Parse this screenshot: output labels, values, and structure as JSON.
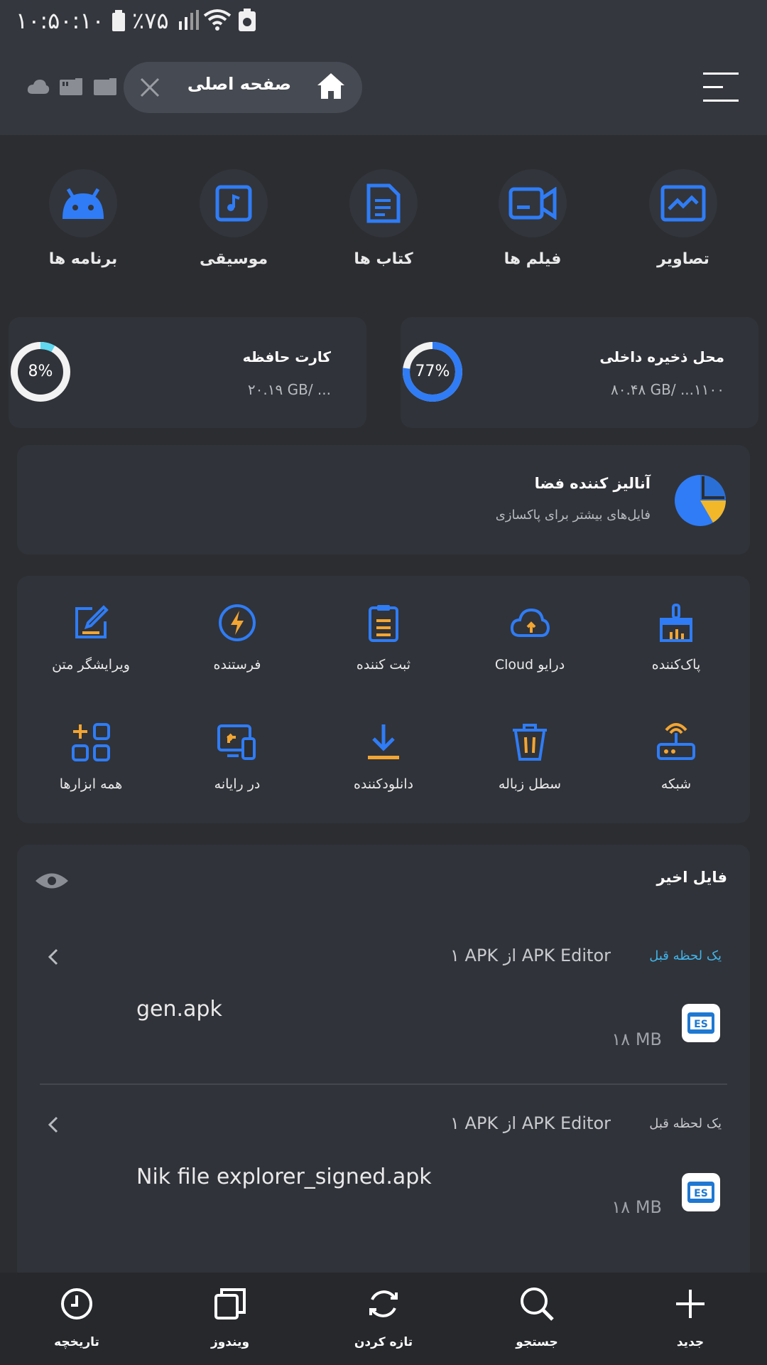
{
  "status_bar": {
    "time": "۱۰:۵۰:۱۰",
    "battery": "٪۷۵"
  },
  "header": {
    "tab_title": "صفحه اصلی"
  },
  "categories": [
    {
      "label": "تصاویر",
      "icon": "image-icon"
    },
    {
      "label": "فیلم ها",
      "icon": "video-icon"
    },
    {
      "label": "کتاب ها",
      "icon": "document-icon"
    },
    {
      "label": "موسیقی",
      "icon": "music-icon"
    },
    {
      "label": "برنامه ها",
      "icon": "android-icon"
    }
  ],
  "storage": {
    "internal": {
      "title": "محل ذخیره داخلی",
      "usage": "۸۰.۴۸ GB/ ...۱۱۰۰",
      "percent": "77%",
      "fraction": 0.77
    },
    "sdcard": {
      "title": "کارت حافظه",
      "usage": "۲۰.۱۹ GB/ ...",
      "percent": "8%",
      "fraction": 0.08
    }
  },
  "analyzer": {
    "title": "آنالیز کننده فضا",
    "subtitle": "فایل‌های بیشتر برای پاکسازی"
  },
  "tools": [
    {
      "label": "پاک‌کننده",
      "icon": "broom-icon"
    },
    {
      "label": "Cloud درایو",
      "icon": "cloud-upload-icon"
    },
    {
      "label": "ثبت کننده",
      "icon": "clipboard-icon"
    },
    {
      "label": "فرستنده",
      "icon": "lightning-icon"
    },
    {
      "label": "ویرایشگر متن",
      "icon": "edit-icon"
    },
    {
      "label": "شبکه",
      "icon": "router-icon"
    },
    {
      "label": "سطل زباله",
      "icon": "trash-icon"
    },
    {
      "label": "دانلودکننده",
      "icon": "download-icon"
    },
    {
      "label": "در رایانه",
      "icon": "cast-icon"
    },
    {
      "label": "همه ابزارها",
      "icon": "grid-icon"
    }
  ],
  "recent": {
    "title": "فایل اخیر",
    "items": [
      {
        "time": "یک لحظه قبل",
        "source": "۱ APK از APK Editor",
        "name": "gen.apk",
        "size": "۱۸ MB"
      },
      {
        "time": "یک لحظه قبل",
        "source": "۱ APK از APK Editor",
        "name": "Nik file explorer_signed.apk",
        "size": "۱۸ MB"
      }
    ]
  },
  "bottom_nav": [
    {
      "label": "جدید",
      "icon": "plus-icon"
    },
    {
      "label": "جستجو",
      "icon": "search-icon"
    },
    {
      "label": "تازه کردن",
      "icon": "refresh-icon"
    },
    {
      "label": "ویندوز",
      "icon": "windows-icon"
    },
    {
      "label": "تاریخچه",
      "icon": "history-icon"
    }
  ],
  "colors": {
    "accent_blue": "#2f7cf6",
    "accent_orange": "#f3a532",
    "ring_blue": "#2f7cf6",
    "ring_cyan": "#5fd8f0"
  }
}
